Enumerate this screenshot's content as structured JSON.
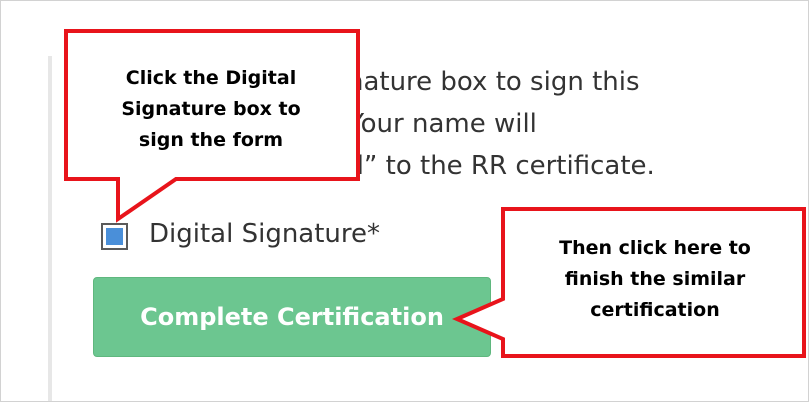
{
  "form": {
    "instruction_text": "Click the Digital Signature box to sign this\nform electronically. Your name will\nbe added as “Signed” to the RR certificate.",
    "digital_signature_label": "Digital Signature*",
    "digital_signature_checked": true,
    "complete_button_label": "Complete Certification"
  },
  "annotations": {
    "callout_1_text": "Click the Digital\nSignature box to\nsign the form",
    "callout_2_text": "Then click here to\nfinish the similar\ncertification"
  },
  "colors": {
    "annotation_border": "#e8141b",
    "button_background": "#6cc690",
    "checkbox_fill": "#4a8fd9"
  },
  "icons": {
    "checkbox": "checkbox-checked-icon"
  }
}
